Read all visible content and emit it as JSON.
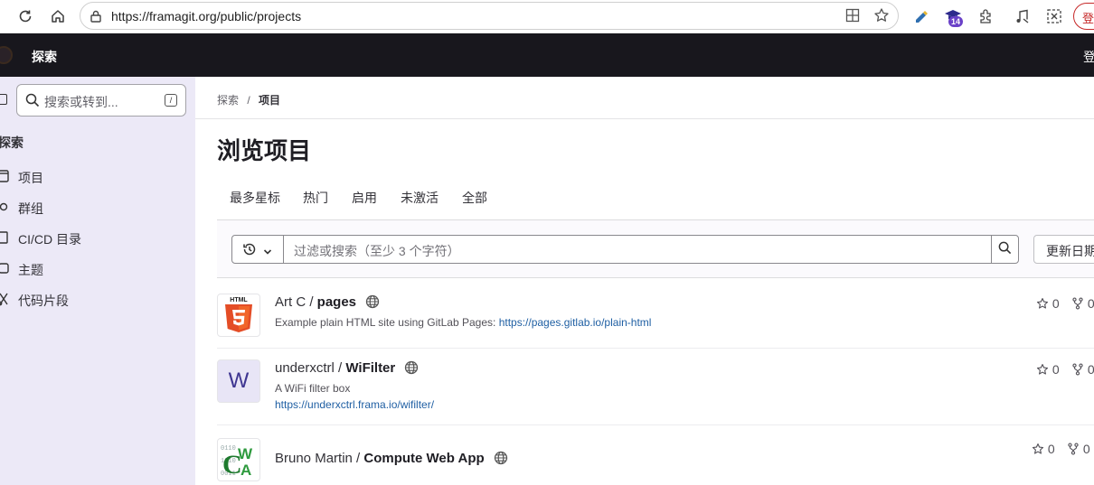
{
  "browser": {
    "url": "https://framagit.org/public/projects",
    "extension_badge": "14",
    "login_button": "登"
  },
  "topbar": {
    "title": "探索",
    "right_text": "登"
  },
  "sidebar": {
    "search_placeholder": "搜索或转到...",
    "search_shortcut": "/",
    "section_title": "探索",
    "items": [
      {
        "label": "项目",
        "icon": "project-icon"
      },
      {
        "label": "群组",
        "icon": "group-icon"
      },
      {
        "label": "CI/CD 目录",
        "icon": "catalog-icon"
      },
      {
        "label": "主题",
        "icon": "topic-icon"
      },
      {
        "label": "代码片段",
        "icon": "snippet-icon"
      }
    ]
  },
  "breadcrumb": {
    "root": "探索",
    "separator": "/",
    "current": "项目"
  },
  "page_title": "浏览项目",
  "tabs": [
    "最多星标",
    "热门",
    "启用",
    "未激活",
    "全部"
  ],
  "filter": {
    "placeholder": "过滤或搜索（至少 3 个字符）",
    "sort_label": "更新日期"
  },
  "projects": [
    {
      "namespace": "Art C / ",
      "name": "pages",
      "description": "Example plain HTML site using GitLab Pages: ",
      "description_link": "https://pages.gitlab.io/plain-html",
      "stars": "0",
      "forks": "0",
      "avatar": "html5-logo"
    },
    {
      "namespace": "underxctrl / ",
      "name": "WiFilter",
      "description": "A WiFi filter box",
      "link": "https://underxctrl.frama.io/wifilter/",
      "stars": "0",
      "forks": "0",
      "avatar_letter": "W"
    },
    {
      "namespace": "Bruno Martin / ",
      "name": "Compute Web App",
      "stars": "0",
      "forks": "0",
      "avatar": "cwa-logo"
    }
  ],
  "colors": {
    "topbar_bg": "#18171d",
    "sidebar_bg": "#ece9f7",
    "link": "#1f5fa3"
  }
}
